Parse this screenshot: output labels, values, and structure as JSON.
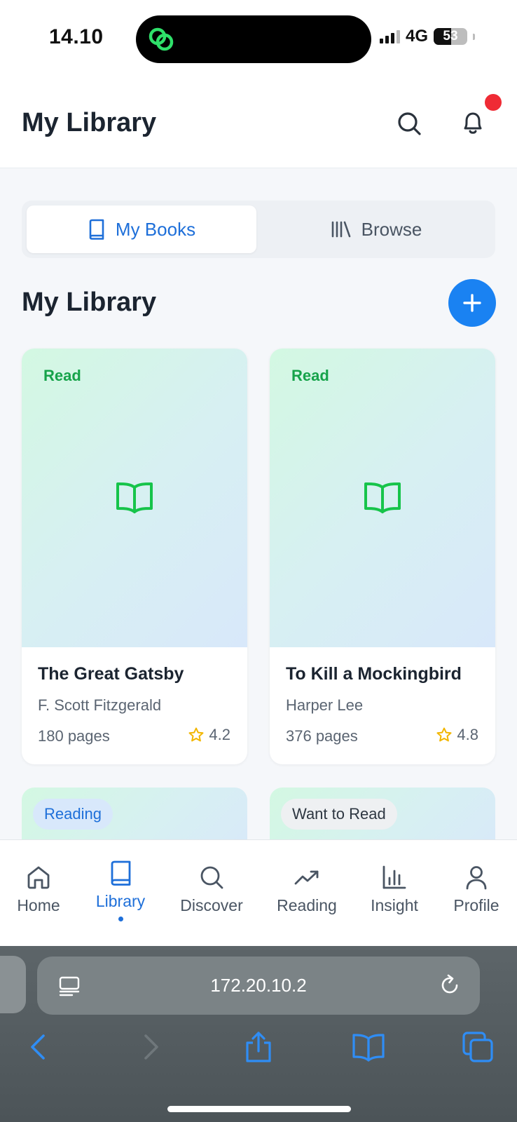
{
  "status_bar": {
    "time": "14.10",
    "network": "4G",
    "battery": "53",
    "battery_level": 0.53
  },
  "header": {
    "title": "My Library"
  },
  "tabs": [
    {
      "label": "My Books",
      "icon": "book-icon",
      "active": true
    },
    {
      "label": "Browse",
      "icon": "library-shelf-icon",
      "active": false
    }
  ],
  "section": {
    "title": "My Library"
  },
  "books": [
    {
      "status": "Read",
      "title": "The Great Gatsby",
      "author": "F. Scott Fitzgerald",
      "pages": "180 pages",
      "rating": "4.2"
    },
    {
      "status": "Read",
      "title": "To Kill a Mockingbird",
      "author": "Harper Lee",
      "pages": "376 pages",
      "rating": "4.8"
    }
  ],
  "partial_books": [
    {
      "status": "Reading"
    },
    {
      "status": "Want to Read"
    }
  ],
  "nav": [
    {
      "label": "Home",
      "icon": "home-icon"
    },
    {
      "label": "Library",
      "icon": "book-icon",
      "active": true
    },
    {
      "label": "Discover",
      "icon": "search-icon"
    },
    {
      "label": "Reading",
      "icon": "trending-up-icon"
    },
    {
      "label": "Insight",
      "icon": "bar-chart-icon"
    },
    {
      "label": "Profile",
      "icon": "user-icon"
    }
  ],
  "browser": {
    "url": "172.20.10.2"
  },
  "colors": {
    "accent": "#1a82f2",
    "active": "#1e6fd9",
    "read_green": "#16a34a",
    "notification": "#ef2b35"
  }
}
